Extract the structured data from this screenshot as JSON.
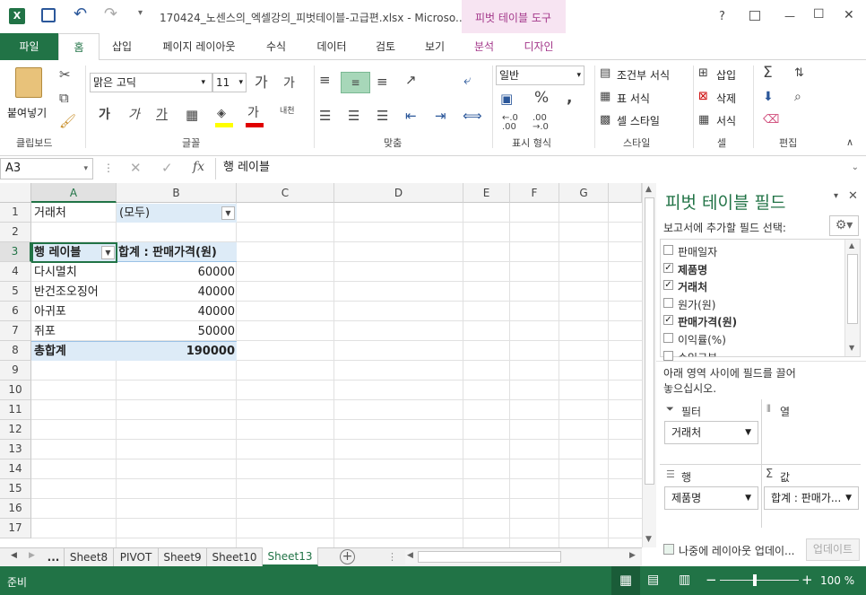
{
  "titlebar": {
    "filename": "170424_노센스의_엑셀강의_피벗테이블-고급편.xlsx - Microso...",
    "context_tab": "피벗 테이블 도구",
    "help": "?",
    "minimize": "—",
    "restore": "☐",
    "close": "✕"
  },
  "tabs": {
    "file": "파일",
    "items": [
      "홈",
      "삽입",
      "페이지 레이아웃",
      "수식",
      "데이터",
      "검토",
      "보기",
      "분석",
      "디자인"
    ]
  },
  "ribbon": {
    "paste": "붙여넣기",
    "font_name": "맑은 고딕",
    "font_size": "11",
    "number_format": "일반",
    "cond_format": "조건부 서식",
    "table_format": "표 서식",
    "cell_style": "셀 스타일",
    "insert": "삽입",
    "delete": "삭제",
    "format": "서식",
    "groups": [
      "클립보드",
      "글꼴",
      "맞춤",
      "표시 형식",
      "스타일",
      "셀",
      "편집"
    ]
  },
  "formula": {
    "name_box": "A3",
    "value": "행 레이블"
  },
  "grid": {
    "columns": [
      "A",
      "B",
      "C",
      "D",
      "E",
      "F",
      "G"
    ],
    "rows": [
      "1",
      "2",
      "3",
      "4",
      "5",
      "6",
      "7",
      "8",
      "9",
      "10",
      "11",
      "12",
      "13",
      "14",
      "15",
      "16",
      "17"
    ],
    "a1": "거래처",
    "b1": "(모두)",
    "a3": "행 레이블",
    "b3": "합계 : 판매가격(원)",
    "data": [
      {
        "label": "다시멸치",
        "value": "60000"
      },
      {
        "label": "반건조오징어",
        "value": "40000"
      },
      {
        "label": "아귀포",
        "value": "40000"
      },
      {
        "label": "쥐포",
        "value": "50000"
      }
    ],
    "total_label": "총합계",
    "total_value": "190000"
  },
  "sheets": {
    "ellipsis": "...",
    "items": [
      "Sheet8",
      "PIVOT",
      "Sheet9",
      "Sheet10",
      "Sheet13"
    ],
    "active": "Sheet13"
  },
  "panel": {
    "title": "피벗 테이블 필드",
    "subtitle": "보고서에 추가할 필드 선택:",
    "fields": [
      {
        "name": "판매일자",
        "checked": false
      },
      {
        "name": "제품명",
        "checked": true
      },
      {
        "name": "거래처",
        "checked": true
      },
      {
        "name": "원가(원)",
        "checked": false
      },
      {
        "name": "판매가격(원)",
        "checked": true
      },
      {
        "name": "이익률(%)",
        "checked": false
      },
      {
        "name": "수입구분",
        "checked": false
      }
    ],
    "drag_hint_1": "아래 영역 사이에 필드를 끌어",
    "drag_hint_2": "놓으십시오.",
    "filter_label": "필터",
    "column_label": "열",
    "row_label": "행",
    "value_label": "값",
    "filter_item": "거래처",
    "row_item": "제품명",
    "value_item": "합계 : 판매가...",
    "defer": "나중에 레이아웃 업데이...",
    "update": "업데이트"
  },
  "status": {
    "ready": "준비",
    "zoom": "100 %"
  },
  "colors": {
    "accent": "#217346",
    "context": "#f7e4f2",
    "header_fill": "#ddebf7"
  }
}
